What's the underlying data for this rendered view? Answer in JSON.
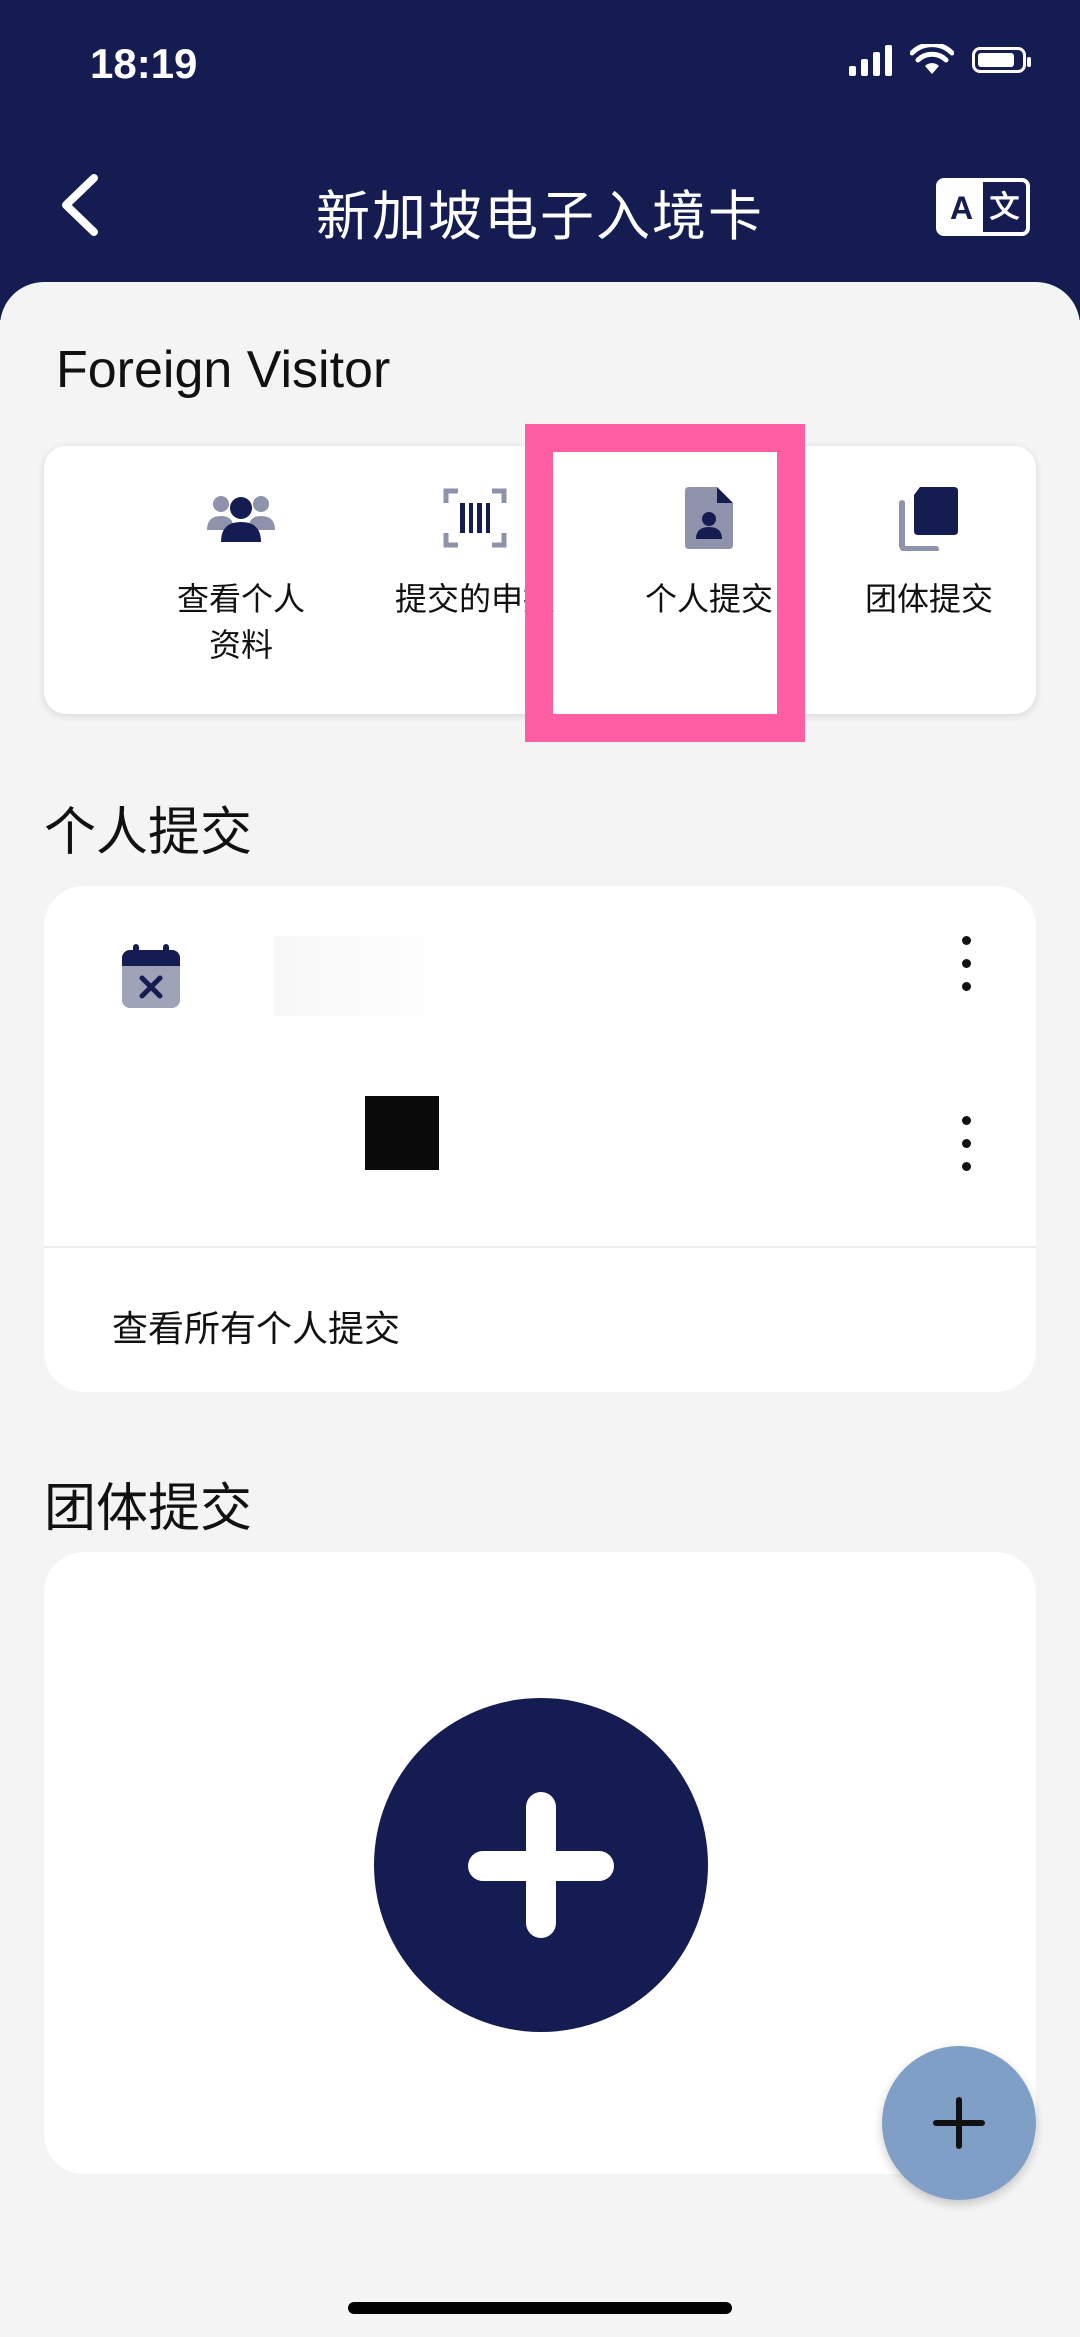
{
  "status_bar": {
    "time": "18:19"
  },
  "header": {
    "title": "新加坡电子入境卡",
    "lang_a": "A",
    "lang_b": "文"
  },
  "visitor_type": "Foreign Visitor",
  "quick_actions": [
    {
      "label": "查看个人资料",
      "icon": "users-icon"
    },
    {
      "label": "提交的申报",
      "icon": "barcode-scan-icon"
    },
    {
      "label": "个人提交",
      "icon": "person-document-icon"
    },
    {
      "label": "团体提交",
      "icon": "copy-documents-icon"
    }
  ],
  "sections": {
    "personal_title": "个人提交",
    "view_all": "查看所有个人提交",
    "group_title": "团体提交"
  },
  "colors": {
    "navy": "#151c52",
    "highlight": "#ff5fa2",
    "fab": "#7f9fc7"
  }
}
